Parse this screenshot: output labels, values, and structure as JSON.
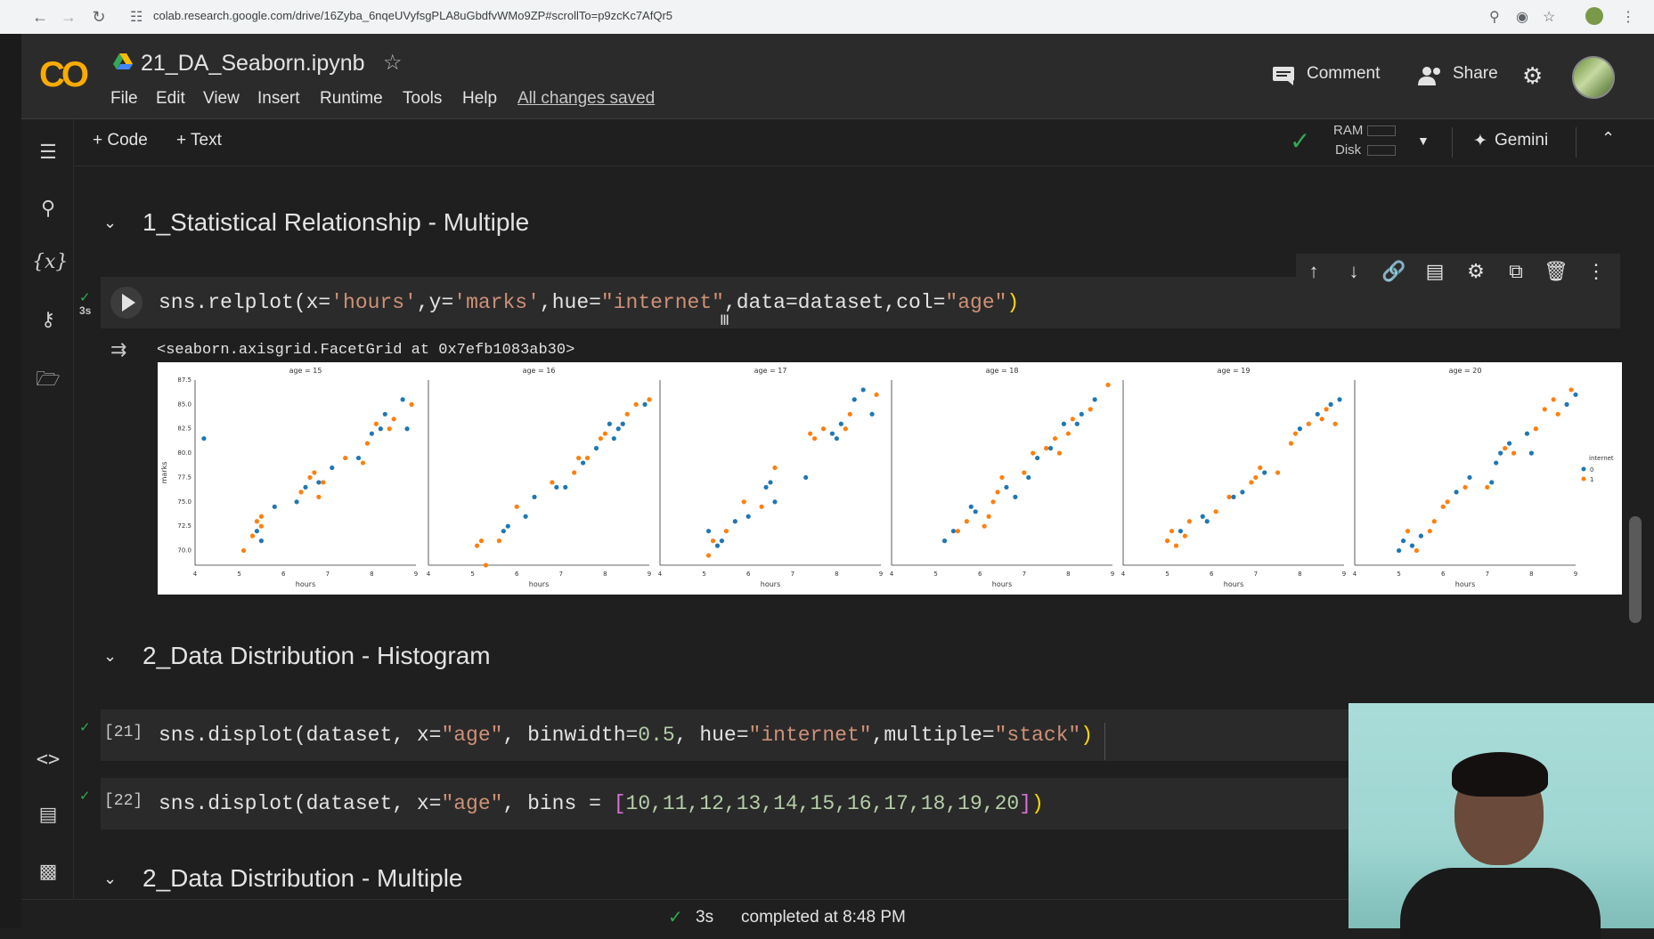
{
  "browser": {
    "url": "colab.research.google.com/drive/16Zyba_6nqeUVyfsgPLA8uGbdfvWMo9ZP#scrollTo=p9zcKc7AfQr5"
  },
  "header": {
    "logo": "CO",
    "notebook_title": "21_DA_Seaborn.ipynb",
    "menu": [
      "File",
      "Edit",
      "View",
      "Insert",
      "Runtime",
      "Tools",
      "Help"
    ],
    "save_status": "All changes saved",
    "comment_label": "Comment",
    "share_label": "Share"
  },
  "toolbar": {
    "add_code": "+ Code",
    "add_text": "+ Text",
    "ram_label": "RAM",
    "disk_label": "Disk",
    "gemini_label": "Gemini"
  },
  "sections": [
    {
      "title": "1_Statistical Relationship - Multiple"
    },
    {
      "title": "2_Data Distribution - Histogram"
    },
    {
      "title": "2_Data Distribution - Multiple"
    }
  ],
  "cells": [
    {
      "exec": "3s",
      "code_parts": [
        "sns.relplot(x=",
        "'hours'",
        ",y=",
        "'marks'",
        ",hue=",
        "\"internet\"",
        ",data=dataset,col=",
        "\"age\"",
        ")"
      ],
      "output": "<seaborn.axisgrid.FacetGrid at 0x7efb1083ab30>"
    },
    {
      "exec": "[21]",
      "code_parts": [
        "sns.displot(dataset, x=",
        "\"age\"",
        ", binwidth=",
        "0.5",
        ", hue=",
        "\"internet\"",
        ",multiple=",
        "\"stack\"",
        ")"
      ]
    },
    {
      "exec": "[22]",
      "code_parts": [
        "sns.displot(dataset, x=",
        "\"age\"",
        ", bins = ",
        "[",
        "10,11,12,13,14,15,16,17,18,19,20",
        "]",
        ")"
      ]
    }
  ],
  "colors": {
    "series_0": "#1f77b4",
    "series_1": "#ff7f0e",
    "accent_green": "#34a853",
    "logo": "#f9ab00"
  },
  "status": {
    "time": "3s",
    "text": "completed at 8:48 PM"
  },
  "chart_data": {
    "type": "scatter",
    "facet_by": "age",
    "facet_titles": [
      "age = 15",
      "age = 16",
      "age = 17",
      "age = 18",
      "age = 19",
      "age = 20"
    ],
    "xlabel": "hours",
    "ylabel": "marks",
    "xlim": [
      4,
      9
    ],
    "ylim": [
      68.5,
      87.5
    ],
    "xticks": [
      4,
      5,
      6,
      7,
      8,
      9
    ],
    "yticks": [
      "70.0",
      "72.5",
      "75.0",
      "77.5",
      "80.0",
      "82.5",
      "85.0",
      "87.5"
    ],
    "legend_title": "internet",
    "legend_position": "right",
    "series": [
      {
        "name": "0",
        "color": "#1f77b4"
      },
      {
        "name": "1",
        "color": "#ff7f0e"
      }
    ],
    "facets": [
      {
        "points": [
          [
            4.2,
            81.5,
            0
          ],
          [
            5.1,
            70.0,
            1
          ],
          [
            5.3,
            71.5,
            1
          ],
          [
            5.4,
            72.0,
            0
          ],
          [
            5.4,
            73.0,
            1
          ],
          [
            5.5,
            73.5,
            1
          ],
          [
            5.5,
            71.0,
            0
          ],
          [
            5.5,
            72.5,
            1
          ],
          [
            5.8,
            74.5,
            0
          ],
          [
            6.3,
            75.0,
            0
          ],
          [
            6.4,
            76.0,
            1
          ],
          [
            6.5,
            76.5,
            0
          ],
          [
            6.6,
            77.5,
            1
          ],
          [
            6.7,
            78.0,
            1
          ],
          [
            6.8,
            77.0,
            0
          ],
          [
            6.8,
            75.5,
            1
          ],
          [
            6.9,
            77.0,
            1
          ],
          [
            7.1,
            78.5,
            0
          ],
          [
            7.4,
            79.5,
            1
          ],
          [
            7.7,
            79.5,
            0
          ],
          [
            7.8,
            79.0,
            1
          ],
          [
            7.9,
            81.0,
            1
          ],
          [
            8.0,
            82.0,
            0
          ],
          [
            8.1,
            83.0,
            1
          ],
          [
            8.2,
            82.5,
            0
          ],
          [
            8.3,
            84.0,
            0
          ],
          [
            8.4,
            82.5,
            1
          ],
          [
            8.5,
            83.5,
            1
          ],
          [
            8.7,
            85.5,
            0
          ],
          [
            8.8,
            82.5,
            0
          ],
          [
            8.9,
            85.0,
            1
          ]
        ]
      },
      {
        "points": [
          [
            5.1,
            70.5,
            1
          ],
          [
            5.2,
            71.0,
            1
          ],
          [
            5.3,
            68.5,
            1
          ],
          [
            5.6,
            71.0,
            1
          ],
          [
            5.7,
            72.0,
            0
          ],
          [
            5.8,
            72.5,
            0
          ],
          [
            6.0,
            74.5,
            1
          ],
          [
            6.2,
            73.5,
            0
          ],
          [
            6.4,
            75.5,
            0
          ],
          [
            6.8,
            77.0,
            1
          ],
          [
            6.9,
            76.5,
            0
          ],
          [
            7.1,
            76.5,
            0
          ],
          [
            7.3,
            78.0,
            1
          ],
          [
            7.4,
            79.5,
            1
          ],
          [
            7.5,
            79.0,
            0
          ],
          [
            7.6,
            79.5,
            1
          ],
          [
            7.8,
            80.5,
            0
          ],
          [
            7.9,
            81.5,
            1
          ],
          [
            8.0,
            82.0,
            1
          ],
          [
            8.1,
            83.0,
            0
          ],
          [
            8.2,
            81.5,
            0
          ],
          [
            8.3,
            82.5,
            0
          ],
          [
            8.4,
            83.0,
            0
          ],
          [
            8.5,
            84.0,
            1
          ],
          [
            8.7,
            85.0,
            1
          ],
          [
            8.9,
            85.0,
            0
          ],
          [
            9.0,
            85.5,
            1
          ]
        ]
      },
      {
        "points": [
          [
            5.1,
            72.0,
            0
          ],
          [
            5.1,
            69.5,
            1
          ],
          [
            5.2,
            71.0,
            1
          ],
          [
            5.3,
            70.5,
            0
          ],
          [
            5.4,
            71.0,
            0
          ],
          [
            5.5,
            72.0,
            1
          ],
          [
            5.7,
            73.0,
            0
          ],
          [
            5.9,
            75.0,
            1
          ],
          [
            6.0,
            73.5,
            0
          ],
          [
            6.3,
            74.5,
            1
          ],
          [
            6.4,
            76.5,
            0
          ],
          [
            6.5,
            77.0,
            0
          ],
          [
            6.6,
            78.5,
            1
          ],
          [
            6.6,
            75.0,
            0
          ],
          [
            7.3,
            77.5,
            0
          ],
          [
            7.4,
            82.0,
            1
          ],
          [
            7.5,
            81.5,
            1
          ],
          [
            7.7,
            82.5,
            1
          ],
          [
            7.9,
            82.0,
            0
          ],
          [
            8.0,
            81.5,
            0
          ],
          [
            8.1,
            83.0,
            0
          ],
          [
            8.2,
            82.5,
            1
          ],
          [
            8.3,
            84.0,
            1
          ],
          [
            8.4,
            85.5,
            0
          ],
          [
            8.6,
            86.5,
            0
          ],
          [
            8.8,
            84.0,
            0
          ],
          [
            8.9,
            86.0,
            1
          ]
        ]
      },
      {
        "points": [
          [
            5.2,
            71.0,
            0
          ],
          [
            5.4,
            72.0,
            0
          ],
          [
            5.5,
            72.0,
            1
          ],
          [
            5.7,
            73.0,
            1
          ],
          [
            5.8,
            74.5,
            0
          ],
          [
            5.9,
            74.0,
            0
          ],
          [
            6.1,
            72.5,
            1
          ],
          [
            6.2,
            73.5,
            1
          ],
          [
            6.3,
            75.0,
            1
          ],
          [
            6.4,
            76.0,
            1
          ],
          [
            6.5,
            77.5,
            1
          ],
          [
            6.6,
            76.5,
            0
          ],
          [
            6.8,
            75.5,
            0
          ],
          [
            7.0,
            78.0,
            1
          ],
          [
            7.1,
            77.5,
            0
          ],
          [
            7.2,
            80.0,
            1
          ],
          [
            7.3,
            79.5,
            0
          ],
          [
            7.5,
            80.5,
            1
          ],
          [
            7.6,
            80.5,
            0
          ],
          [
            7.7,
            81.5,
            1
          ],
          [
            7.8,
            80.0,
            1
          ],
          [
            7.9,
            83.0,
            0
          ],
          [
            8.0,
            82.0,
            1
          ],
          [
            8.1,
            83.5,
            1
          ],
          [
            8.2,
            83.0,
            0
          ],
          [
            8.3,
            84.0,
            0
          ],
          [
            8.5,
            84.5,
            1
          ],
          [
            8.6,
            85.5,
            0
          ],
          [
            8.9,
            87.0,
            1
          ]
        ]
      },
      {
        "points": [
          [
            5.0,
            71.0,
            1
          ],
          [
            5.1,
            72.0,
            1
          ],
          [
            5.2,
            70.5,
            1
          ],
          [
            5.3,
            72.0,
            0
          ],
          [
            5.4,
            71.5,
            1
          ],
          [
            5.5,
            73.0,
            1
          ],
          [
            5.8,
            73.5,
            0
          ],
          [
            5.9,
            73.0,
            0
          ],
          [
            6.1,
            74.0,
            1
          ],
          [
            6.4,
            75.5,
            1
          ],
          [
            6.5,
            75.5,
            0
          ],
          [
            6.7,
            76.0,
            0
          ],
          [
            6.9,
            77.0,
            1
          ],
          [
            7.0,
            77.5,
            1
          ],
          [
            7.1,
            78.5,
            1
          ],
          [
            7.2,
            78.0,
            0
          ],
          [
            7.5,
            78.0,
            1
          ],
          [
            7.8,
            81.0,
            1
          ],
          [
            7.9,
            82.0,
            1
          ],
          [
            8.0,
            82.5,
            0
          ],
          [
            8.2,
            83.0,
            1
          ],
          [
            8.4,
            84.0,
            0
          ],
          [
            8.5,
            83.5,
            1
          ],
          [
            8.6,
            84.5,
            1
          ],
          [
            8.7,
            85.0,
            0
          ],
          [
            8.8,
            83.0,
            1
          ],
          [
            8.9,
            85.5,
            0
          ]
        ]
      },
      {
        "points": [
          [
            5.0,
            70.0,
            0
          ],
          [
            5.1,
            71.0,
            0
          ],
          [
            5.2,
            72.0,
            1
          ],
          [
            5.3,
            70.5,
            0
          ],
          [
            5.4,
            70.0,
            1
          ],
          [
            5.5,
            71.5,
            0
          ],
          [
            5.7,
            72.0,
            1
          ],
          [
            5.8,
            73.0,
            1
          ],
          [
            6.0,
            74.5,
            1
          ],
          [
            6.1,
            75.0,
            1
          ],
          [
            6.3,
            76.0,
            0
          ],
          [
            6.5,
            76.5,
            1
          ],
          [
            6.6,
            77.5,
            0
          ],
          [
            7.0,
            76.5,
            1
          ],
          [
            7.1,
            77.0,
            0
          ],
          [
            7.2,
            79.0,
            0
          ],
          [
            7.3,
            80.0,
            0
          ],
          [
            7.4,
            80.5,
            1
          ],
          [
            7.5,
            81.0,
            0
          ],
          [
            7.6,
            80.0,
            1
          ],
          [
            7.9,
            82.0,
            0
          ],
          [
            8.0,
            80.0,
            0
          ],
          [
            8.1,
            82.5,
            1
          ],
          [
            8.3,
            84.5,
            1
          ],
          [
            8.5,
            85.5,
            1
          ],
          [
            8.6,
            84.0,
            1
          ],
          [
            8.8,
            85.0,
            0
          ],
          [
            8.9,
            86.5,
            1
          ],
          [
            9.0,
            86.0,
            0
          ]
        ]
      }
    ]
  }
}
